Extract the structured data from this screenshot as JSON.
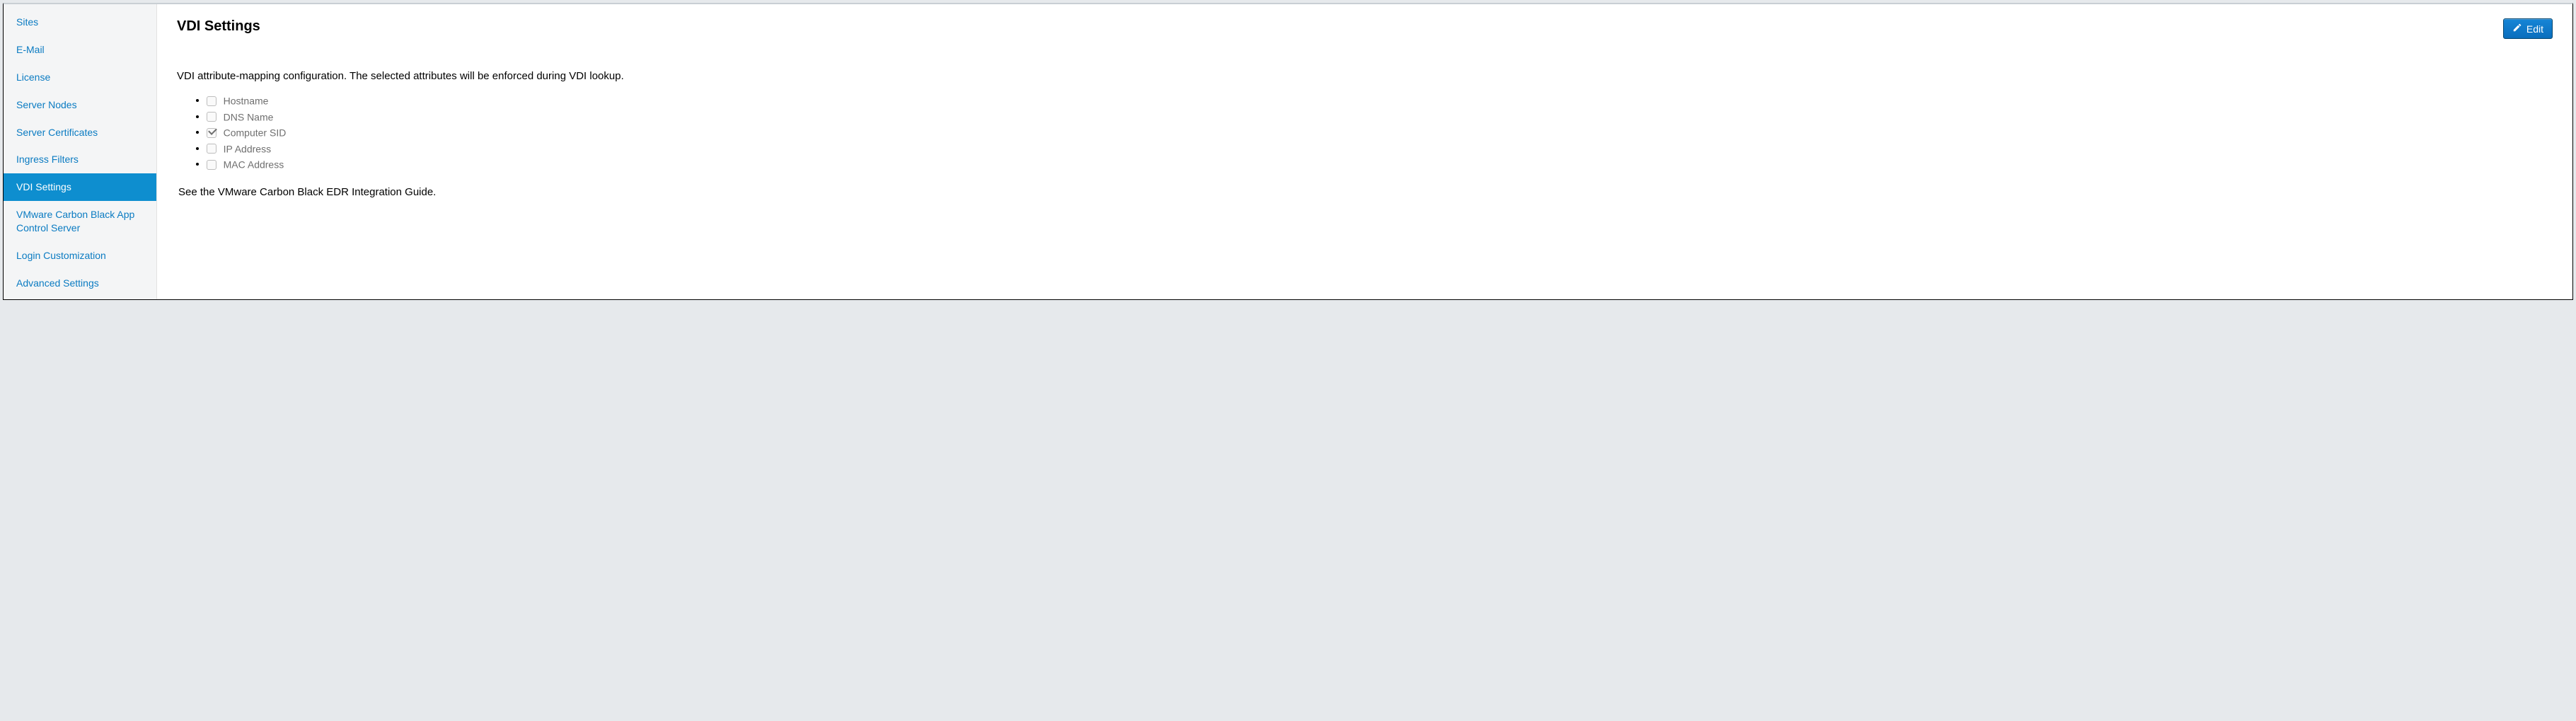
{
  "sidebar": {
    "items": [
      {
        "label": "Sites",
        "active": false
      },
      {
        "label": "E-Mail",
        "active": false
      },
      {
        "label": "License",
        "active": false
      },
      {
        "label": "Server Nodes",
        "active": false
      },
      {
        "label": "Server Certificates",
        "active": false
      },
      {
        "label": "Ingress Filters",
        "active": false
      },
      {
        "label": "VDI Settings",
        "active": true
      },
      {
        "label": "VMware Carbon Black App Control Server",
        "active": false
      },
      {
        "label": "Login Customization",
        "active": false
      },
      {
        "label": "Advanced Settings",
        "active": false
      }
    ]
  },
  "page": {
    "title": "VDI Settings",
    "edit_label": "Edit",
    "description": "VDI attribute-mapping configuration. The selected attributes will be enforced during VDI lookup.",
    "guide_note": "See the VMware Carbon Black EDR Integration Guide."
  },
  "attributes": [
    {
      "label": "Hostname",
      "checked": false
    },
    {
      "label": "DNS Name",
      "checked": false
    },
    {
      "label": "Computer SID",
      "checked": true
    },
    {
      "label": "IP Address",
      "checked": false
    },
    {
      "label": "MAC Address",
      "checked": false
    }
  ]
}
